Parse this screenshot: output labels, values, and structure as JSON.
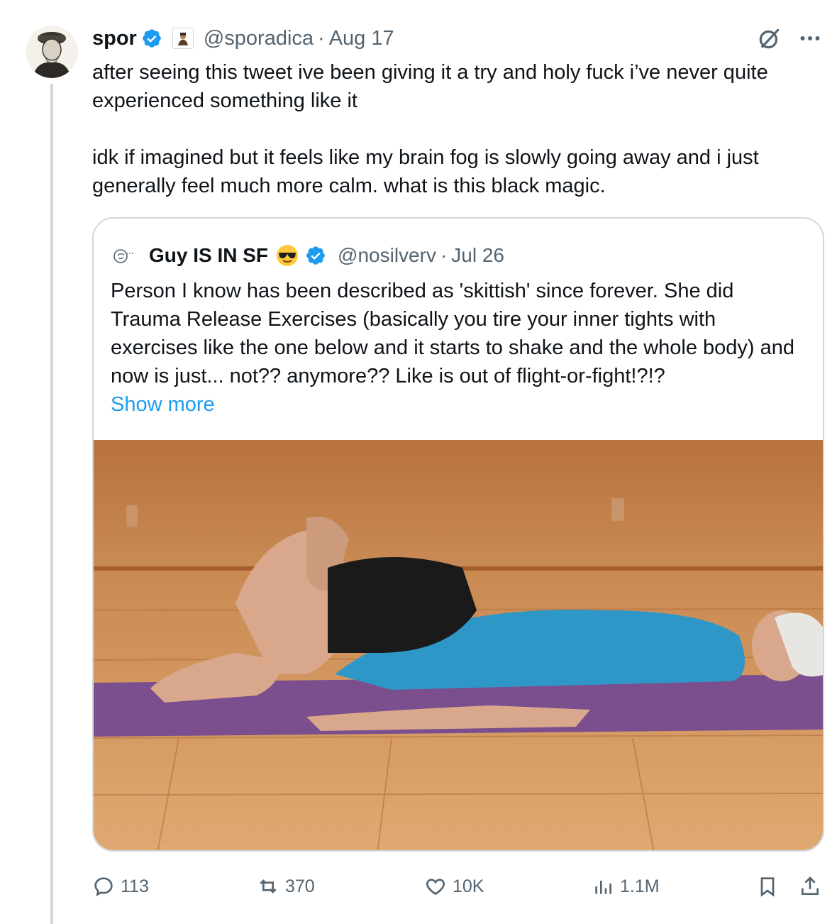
{
  "tweet": {
    "author_name": "spor",
    "author_handle": "@sporadica",
    "separator": "·",
    "date": "Aug 17",
    "paragraphs": [
      "after seeing this tweet ive been giving it a try and holy fuck i’ve never quite experienced something like it",
      "idk if imagined but it feels like my brain fog is slowly going away and i just generally feel much more calm. what is this black magic."
    ]
  },
  "quote": {
    "author_name": "Guy IS IN SF",
    "author_handle": "@nosilverv",
    "separator": "·",
    "date": "Jul 26",
    "text": "Person I know has been described as 'skittish' since forever. She did Trauma Release Exercises (basically you tire your inner tights with exercises like the one below and it starts to shake and the whole body) and now is just... not?? anymore?? Like is out of flight-or-fight!?!?",
    "show_more": "Show more"
  },
  "actions": {
    "replies": "113",
    "reposts": "370",
    "likes": "10K",
    "views": "1.1M"
  },
  "icons": [
    "verified-badge-icon",
    "grok-icon",
    "more-icon",
    "reply-icon",
    "repost-icon",
    "like-icon",
    "views-icon",
    "bookmark-icon",
    "share-icon"
  ],
  "colors": {
    "accent": "#1d9bf0",
    "secondary_text": "#536471",
    "border": "#cfd9de"
  }
}
